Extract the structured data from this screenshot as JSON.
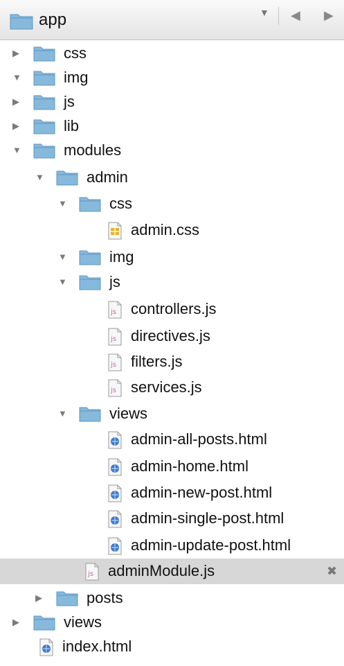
{
  "header": {
    "title": "app",
    "dropdown_icon": "chevron-down-icon",
    "prev_icon": "triangle-left-icon",
    "next_icon": "triangle-right-icon"
  },
  "tree": [
    {
      "label": "css",
      "type": "folder",
      "expanded": false
    },
    {
      "label": "img",
      "type": "folder",
      "expanded": true
    },
    {
      "label": "js",
      "type": "folder",
      "expanded": false
    },
    {
      "label": "lib",
      "type": "folder",
      "expanded": false
    },
    {
      "label": "modules",
      "type": "folder",
      "expanded": true
    },
    {
      "label": "admin",
      "type": "folder",
      "expanded": true
    },
    {
      "label": "css",
      "type": "folder",
      "expanded": true
    },
    {
      "label": "admin.css",
      "type": "css-file"
    },
    {
      "label": "img",
      "type": "folder",
      "expanded": true
    },
    {
      "label": "js",
      "type": "folder",
      "expanded": true
    },
    {
      "label": "controllers.js",
      "type": "js-file"
    },
    {
      "label": "directives.js",
      "type": "js-file"
    },
    {
      "label": "filters.js",
      "type": "js-file"
    },
    {
      "label": "services.js",
      "type": "js-file"
    },
    {
      "label": "views",
      "type": "folder",
      "expanded": true
    },
    {
      "label": "admin-all-posts.html",
      "type": "html-file"
    },
    {
      "label": "admin-home.html",
      "type": "html-file"
    },
    {
      "label": "admin-new-post.html",
      "type": "html-file"
    },
    {
      "label": "admin-single-post.html",
      "type": "html-file"
    },
    {
      "label": "admin-update-post.html",
      "type": "html-file"
    },
    {
      "label": "adminModule.js",
      "type": "js-file",
      "selected": true
    },
    {
      "label": "posts",
      "type": "folder",
      "expanded": false
    },
    {
      "label": "views",
      "type": "folder",
      "expanded": false
    },
    {
      "label": "index.html",
      "type": "html-file"
    }
  ],
  "colors": {
    "folder": "#86b9dc",
    "folder_dark": "#5f97c2",
    "selection": "#d7d7d7",
    "js_icon": "#c46aa8",
    "css_icon": "#e6b422",
    "html_icon": "#3b7ad1"
  }
}
